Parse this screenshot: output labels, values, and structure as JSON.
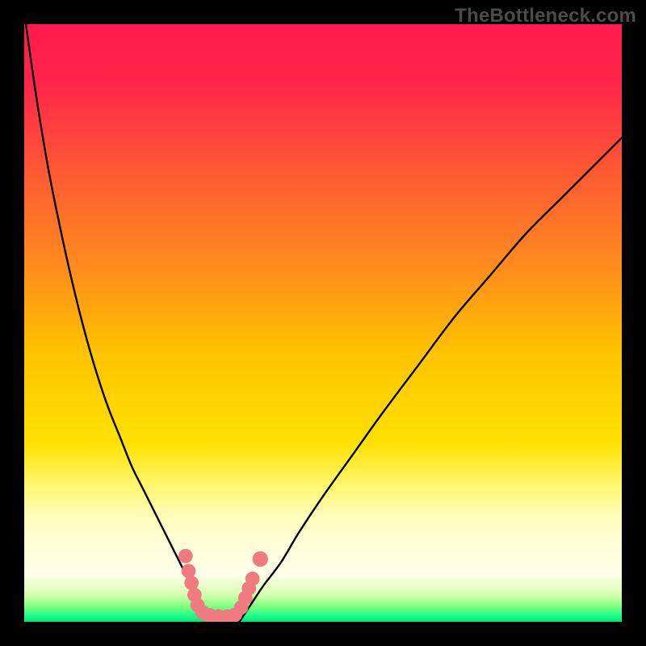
{
  "watermark": "TheBottleneck.com",
  "chart_data": {
    "type": "line",
    "title": "",
    "xlabel": "",
    "ylabel": "",
    "xlim": [
      0,
      100
    ],
    "ylim": [
      0,
      100
    ],
    "gradient_stops": [
      {
        "offset": 0.0,
        "color": "#ff1a4d"
      },
      {
        "offset": 0.1,
        "color": "#ff264a"
      },
      {
        "offset": 0.25,
        "color": "#ff5a33"
      },
      {
        "offset": 0.4,
        "color": "#ff8a1f"
      },
      {
        "offset": 0.55,
        "color": "#ffc300"
      },
      {
        "offset": 0.7,
        "color": "#ffe100"
      },
      {
        "offset": 0.78,
        "color": "#fff97a"
      },
      {
        "offset": 0.82,
        "color": "#fffbb6"
      },
      {
        "offset": 0.86,
        "color": "#fffdd4"
      },
      {
        "offset": 0.92,
        "color": "#ffffe8"
      },
      {
        "offset": 0.955,
        "color": "#d4ffb0"
      },
      {
        "offset": 0.975,
        "color": "#7cff7c"
      },
      {
        "offset": 0.99,
        "color": "#1aff8a"
      },
      {
        "offset": 1.0,
        "color": "#00e676"
      }
    ],
    "series": [
      {
        "name": "left-curve",
        "x": [
          0,
          2,
          4,
          6,
          8,
          10,
          12,
          14,
          16,
          18,
          20,
          22,
          24,
          26,
          27,
          28,
          29,
          30,
          31
        ],
        "y": [
          102,
          88,
          76,
          66,
          57,
          49,
          42,
          36,
          31,
          26,
          22,
          18,
          14,
          10,
          8,
          6,
          4,
          2,
          0
        ]
      },
      {
        "name": "right-curve",
        "x": [
          36,
          38,
          40,
          43,
          46,
          50,
          55,
          60,
          66,
          72,
          78,
          84,
          90,
          96,
          100
        ],
        "y": [
          0,
          3,
          6,
          10,
          15,
          21,
          28,
          35,
          43,
          51,
          58,
          65,
          71,
          77,
          81
        ]
      }
    ],
    "bottom_markers": {
      "name": "dotted-region",
      "points": [
        {
          "x": 27.0,
          "y": 11.0,
          "r": 1.2
        },
        {
          "x": 27.5,
          "y": 8.5,
          "r": 1.2
        },
        {
          "x": 28.0,
          "y": 6.5,
          "r": 1.2
        },
        {
          "x": 28.5,
          "y": 4.5,
          "r": 1.2
        },
        {
          "x": 29.0,
          "y": 2.8,
          "r": 1.2
        },
        {
          "x": 29.8,
          "y": 1.6,
          "r": 1.2
        },
        {
          "x": 31.0,
          "y": 1.0,
          "r": 1.3
        },
        {
          "x": 32.5,
          "y": 0.8,
          "r": 1.3
        },
        {
          "x": 34.0,
          "y": 0.8,
          "r": 1.3
        },
        {
          "x": 35.3,
          "y": 1.2,
          "r": 1.2
        },
        {
          "x": 36.3,
          "y": 2.4,
          "r": 1.2
        },
        {
          "x": 37.0,
          "y": 4.0,
          "r": 1.2
        },
        {
          "x": 37.6,
          "y": 5.6,
          "r": 1.2
        },
        {
          "x": 38.2,
          "y": 7.2,
          "r": 1.2
        },
        {
          "x": 39.5,
          "y": 10.5,
          "r": 1.3
        }
      ],
      "color": "#ef7a7f"
    }
  }
}
